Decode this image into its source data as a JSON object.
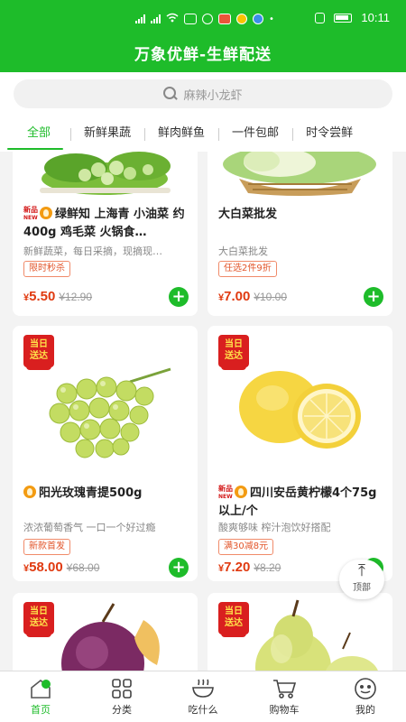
{
  "status_bar": {
    "time": "10:11",
    "network_left": "4G",
    "network_right": "5G"
  },
  "app": {
    "title": "万象优鲜-生鲜配送"
  },
  "search": {
    "placeholder": "麻辣小龙虾"
  },
  "tabs": [
    {
      "label": "全部"
    },
    {
      "label": "新鲜果蔬"
    },
    {
      "label": "鲜肉鲜鱼"
    },
    {
      "label": "一件包邮"
    },
    {
      "label": "时令尝鲜"
    }
  ],
  "badges": {
    "new": "新品",
    "new_sub": "NEW",
    "same_day": "当日",
    "same_day_2": "送达"
  },
  "currency": "¥",
  "products": [
    {
      "title": "绿鲜知 上海青 小油菜 约400g 鸡毛菜 火锅食…",
      "desc": "新鲜蔬菜，每日采摘，现摘现…",
      "promo": "限时秒杀",
      "price": "5.50",
      "old_price": "¥12.90",
      "is_new": true,
      "hot": true,
      "same_day": false
    },
    {
      "title": "大白菜批发",
      "desc": "大白菜批发",
      "promo": "任选2件9折",
      "price": "7.00",
      "old_price": "¥10.00",
      "is_new": false,
      "hot": false,
      "same_day": false
    },
    {
      "title": "阳光玫瑰青提500g",
      "desc": "浓浓葡萄香气 一口一个好过瘾",
      "promo": "新款首发",
      "price": "58.00",
      "old_price": "¥68.00",
      "is_new": false,
      "hot": true,
      "same_day": true
    },
    {
      "title": "四川安岳黄柠檬4个75g以上/个",
      "desc": "酸爽够味 榨汁泡饮好搭配",
      "promo": "满30减8元",
      "price": "7.20",
      "old_price": "¥8.20",
      "is_new": true,
      "hot": true,
      "same_day": true
    },
    {
      "title": "",
      "desc": "",
      "promo": "",
      "price": "",
      "old_price": "",
      "same_day": true
    },
    {
      "title": "",
      "desc": "",
      "promo": "",
      "price": "",
      "old_price": "",
      "same_day": true
    }
  ],
  "back_to_top": {
    "label": "顶部"
  },
  "bottom_nav": [
    {
      "label": "首页",
      "icon": "home-icon"
    },
    {
      "label": "分类",
      "icon": "grid-icon"
    },
    {
      "label": "吃什么",
      "icon": "bowl-icon"
    },
    {
      "label": "购物车",
      "icon": "cart-icon"
    },
    {
      "label": "我的",
      "icon": "profile-icon"
    }
  ],
  "colors": {
    "brand": "#1ebc2a",
    "price": "#e03a10",
    "badge": "#d91f1f"
  }
}
